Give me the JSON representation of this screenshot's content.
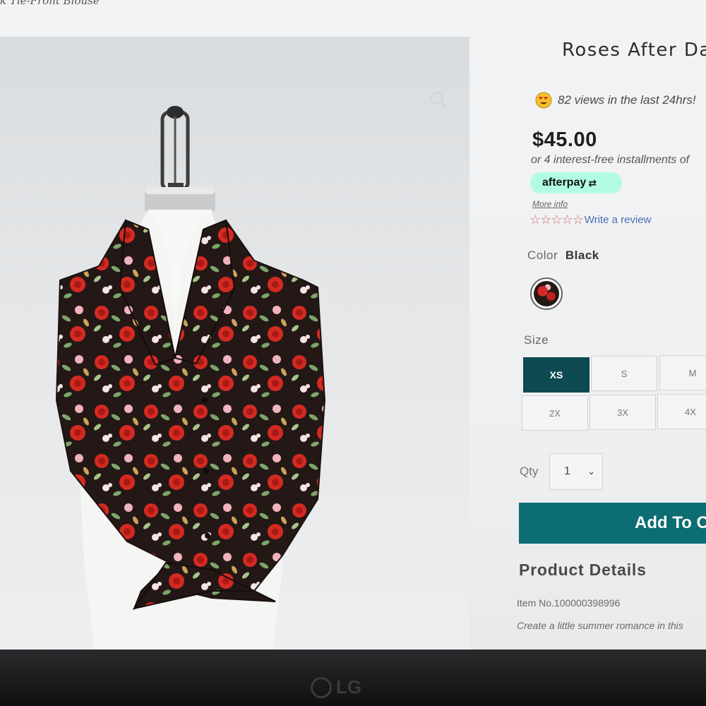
{
  "breadcrumb": {
    "text": "k Tie-Front Blouse"
  },
  "gallery": {
    "zoom_icon": "magnifier-icon"
  },
  "product": {
    "title": "Roses After Dar",
    "views_emoji": "heart-eyes-emoji-icon",
    "views_text": "82 views in the last 24hrs!",
    "price": "$45.00",
    "installments_text": "or 4 interest-free installments of",
    "afterpay_label": "afterpay",
    "afterpay_arrows": "⇄",
    "more_info": "More info",
    "rating_stars": 0,
    "write_review": "Write a review",
    "color_label": "Color",
    "color_value": "Black",
    "size_label": "Size",
    "sizes": [
      "XS",
      "S",
      "M",
      "2X",
      "3X",
      "4X"
    ],
    "selected_size": "XS",
    "qty_label": "Qty",
    "qty_value": "1",
    "add_to_cart": "Add To C",
    "details_heading": "Product Details",
    "item_no": "Item No.100000398996",
    "description": "Create a little summer romance in this"
  },
  "monitor": {
    "brand": "LG"
  },
  "colors": {
    "accent_teal": "#0c6d72",
    "selected_size_bg": "#0e4a52",
    "afterpay_mint": "#b2fce4",
    "review_link": "#4a6fb5",
    "star_outline": "#d06a6a"
  }
}
